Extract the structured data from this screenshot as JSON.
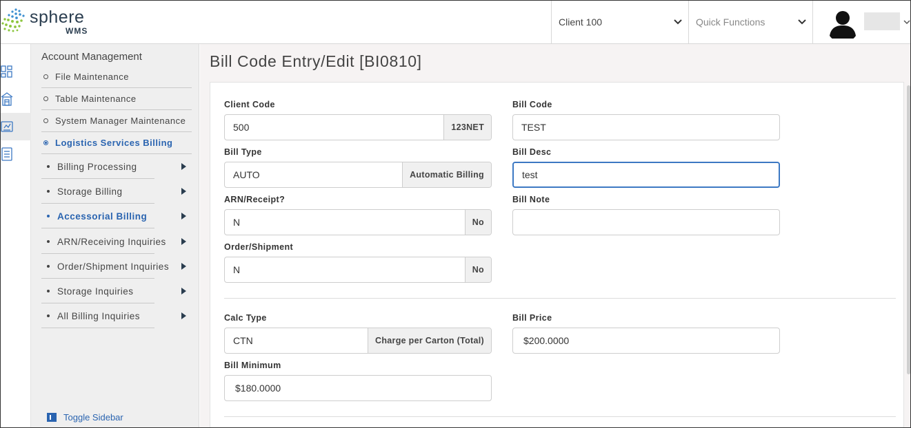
{
  "header": {
    "logo_text": "sphere",
    "logo_sub": "WMS",
    "client_select": "Client 100",
    "quick_functions": "Quick Functions"
  },
  "sidebar": {
    "title": "Account Management",
    "level1": [
      {
        "label": "File Maintenance",
        "active": false
      },
      {
        "label": "Table Maintenance",
        "active": false
      },
      {
        "label": "System Manager Maintenance",
        "active": false
      },
      {
        "label": "Logistics Services Billing",
        "active": true
      }
    ],
    "level2": [
      {
        "label": "Billing Processing",
        "active": false
      },
      {
        "label": "Storage Billing",
        "active": false
      },
      {
        "label": "Accessorial Billing",
        "active": true
      },
      {
        "label": "ARN/Receiving Inquiries",
        "active": false
      },
      {
        "label": "Order/Shipment Inquiries",
        "active": false
      },
      {
        "label": "Storage Inquiries",
        "active": false
      },
      {
        "label": "All Billing Inquiries",
        "active": false
      }
    ],
    "toggle_label": "Toggle Sidebar"
  },
  "page": {
    "title": "Bill Code Entry/Edit [BI0810]"
  },
  "form": {
    "client_code": {
      "label": "Client Code",
      "value": "500",
      "addon": "123NET"
    },
    "bill_code": {
      "label": "Bill Code",
      "value": "TEST"
    },
    "bill_type": {
      "label": "Bill Type",
      "value": "AUTO",
      "addon": "Automatic Billing"
    },
    "bill_desc": {
      "label": "Bill Desc",
      "value": "test"
    },
    "arn_receipt": {
      "label": "ARN/Receipt?",
      "value": "N",
      "addon": "No"
    },
    "bill_note": {
      "label": "Bill Note",
      "value": ""
    },
    "order_shipment": {
      "label": "Order/Shipment",
      "value": "N",
      "addon": "No"
    },
    "calc_type": {
      "label": "Calc Type",
      "value": "CTN",
      "addon": "Charge per Carton (Total)"
    },
    "bill_price": {
      "label": "Bill Price",
      "value": "$200.0000"
    },
    "bill_minimum": {
      "label": "Bill Minimum",
      "value": "$180.0000"
    }
  },
  "colors": {
    "accent": "#2a64b0",
    "focus_border": "#3c78c3",
    "sidebar_bg": "#efefef",
    "main_bg": "#f6f3f3"
  }
}
